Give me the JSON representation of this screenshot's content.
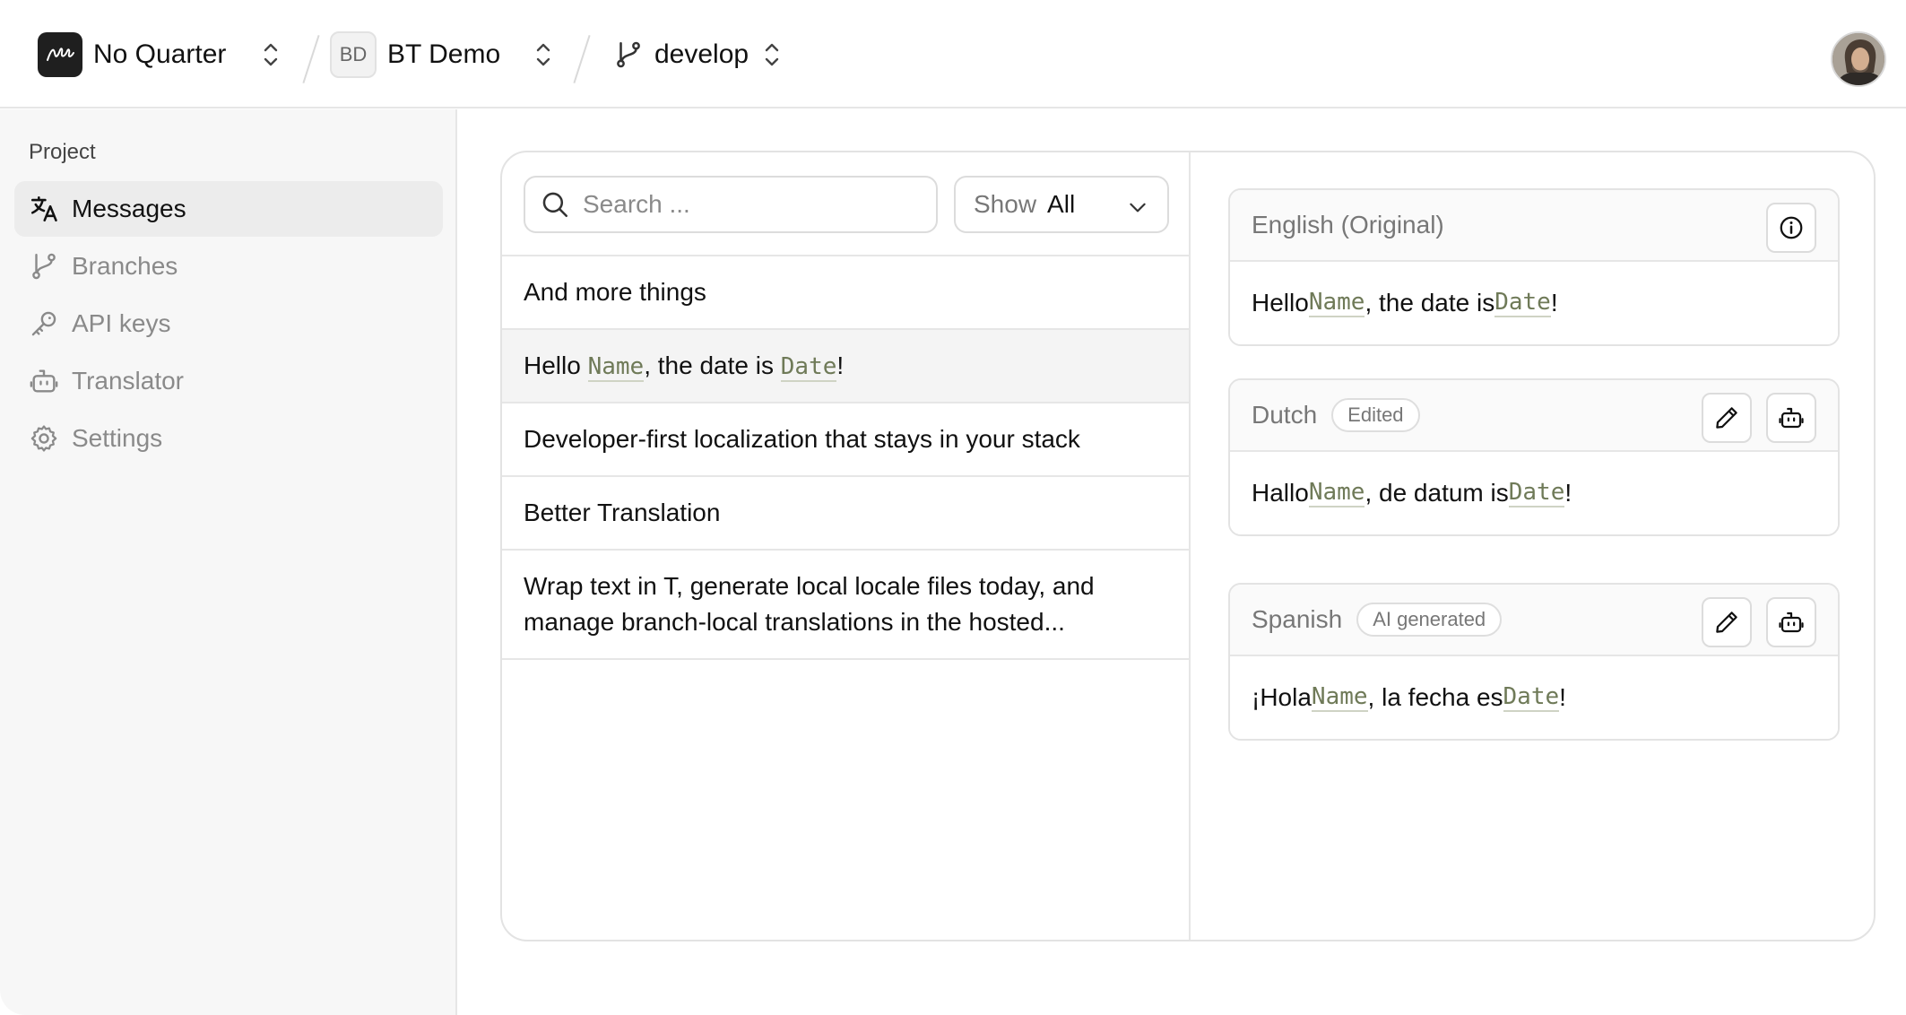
{
  "topbar": {
    "org_name": "No Quarter",
    "project_initials": "BD",
    "project_name": "BT Demo",
    "branch_name": "develop"
  },
  "sidebar": {
    "section_label": "Project",
    "items": [
      {
        "label": "Messages",
        "icon": "translate-icon",
        "active": true
      },
      {
        "label": "Branches",
        "icon": "branch-icon"
      },
      {
        "label": "API keys",
        "icon": "key-icon"
      },
      {
        "label": "Translator",
        "icon": "bot-icon"
      },
      {
        "label": "Settings",
        "icon": "gear-icon"
      }
    ]
  },
  "messages": {
    "search_placeholder": "Search ...",
    "filter_label": "Show",
    "filter_value": "All",
    "rows": [
      {
        "text": "And more things"
      },
      {
        "before": "Hello ",
        "var1": "Name",
        "middle": ", the date is ",
        "var2": "Date",
        "after": "!"
      },
      {
        "text": "Developer-first localization that stays in your stack"
      },
      {
        "text": "Better Translation"
      },
      {
        "line1": "Wrap text in T, generate local locale files today, and",
        "line2": "manage branch-local translations in the hosted..."
      }
    ]
  },
  "translations": [
    {
      "language": "English (Original)",
      "before": "Hello ",
      "var1": "Name",
      "middle": ", the date is ",
      "var2": "Date",
      "after": "!"
    },
    {
      "language": "Dutch",
      "badge": "Edited",
      "before": "Hallo ",
      "var1": "Name",
      "middle": ", de datum is ",
      "var2": "Date",
      "after": "!"
    },
    {
      "language": "Spanish",
      "badge": "AI generated",
      "before": "¡Hola ",
      "var1": "Name",
      "middle": ", la fecha es ",
      "var2": "Date",
      "after": "!"
    }
  ],
  "colors": {
    "variable_text": "#6f7a58",
    "sidebar_bg": "#f7f7f7",
    "active_item_bg": "#ececec",
    "border": "#e3e3e3"
  }
}
